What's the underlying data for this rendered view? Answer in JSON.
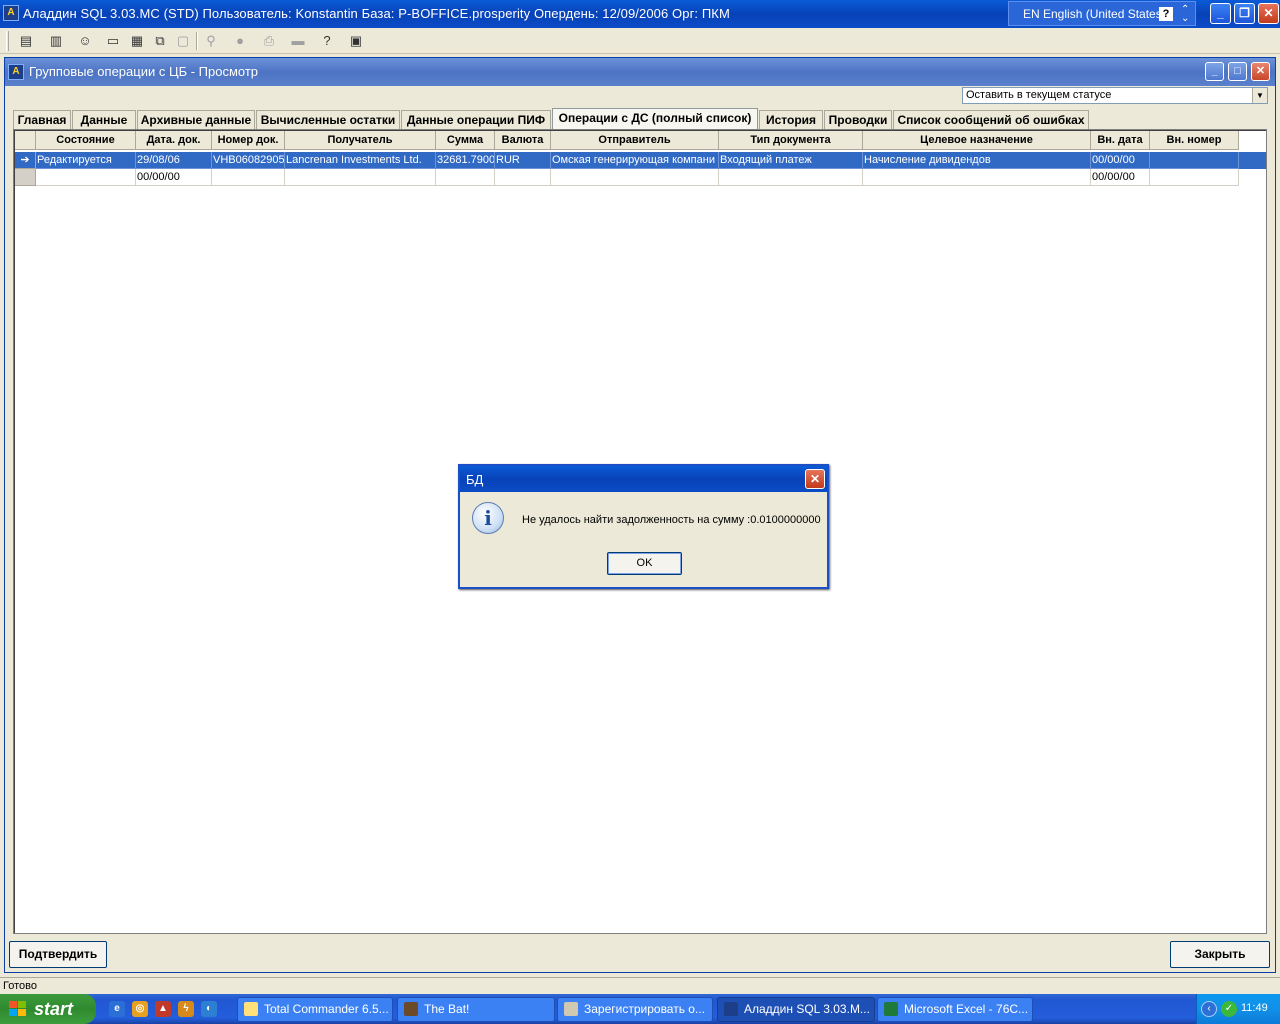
{
  "app": {
    "title": "Аладдин SQL 3.03.MC (STD)  Пользователь: Konstantin База: P-BOFFICE.prosperity Опердень: 12/09/2006 Орг: ПКМ",
    "language": "EN English (United States)"
  },
  "child": {
    "title": "Групповые операции с ЦБ - Просмотр",
    "status_select": "Оставить в текущем статусе"
  },
  "tabs": [
    {
      "label": "Главная"
    },
    {
      "label": "Данные"
    },
    {
      "label": "Архивные данные"
    },
    {
      "label": "Вычисленные остатки"
    },
    {
      "label": "Данные операции ПИФ"
    },
    {
      "label": "Операции с ДС (полный список)"
    },
    {
      "label": "История"
    },
    {
      "label": "Проводки"
    },
    {
      "label": "Список сообщений об ошибках"
    }
  ],
  "grid": {
    "columns": [
      "Состояние",
      "Дата. док.",
      "Номер док.",
      "Получатель",
      "Сумма",
      "Валюта",
      "Отправитель",
      "Тип документа",
      "Целевое назначение",
      "Вн. дата",
      "Вн. номер"
    ],
    "rows": [
      [
        "Редактируется",
        "29/08/06",
        "VHB06082905",
        "Lancrenan Investments Ltd.",
        "32681.7900",
        "RUR",
        "Омская генерирующая компани",
        "Входящий платеж",
        "Начисление дивидендов",
        "00/00/00",
        ""
      ],
      [
        "",
        "00/00/00",
        "",
        "",
        "",
        "",
        "",
        "",
        "",
        "00/00/00",
        ""
      ]
    ],
    "current_row_indicator": "➔"
  },
  "buttons": {
    "confirm": "Подтвердить",
    "close": "Закрыть"
  },
  "dialog": {
    "title": "БД",
    "message": "Не удалось найти задолженность на сумму :0.0100000000",
    "ok": "OK"
  },
  "statusbar": {
    "text": "Готово"
  },
  "taskbar": {
    "start": "start",
    "tasks": [
      {
        "label": "Total Commander 6.5..."
      },
      {
        "label": "The Bat!"
      },
      {
        "label": "Зарегистрировать о..."
      },
      {
        "label": "Аладдин SQL 3.03.M..."
      },
      {
        "label": "Microsoft Excel - 76C..."
      }
    ],
    "clock": "11:49"
  },
  "colors": {
    "selection": "#316ac5",
    "title_blue": "#0842b8",
    "face": "#ece9d8"
  }
}
